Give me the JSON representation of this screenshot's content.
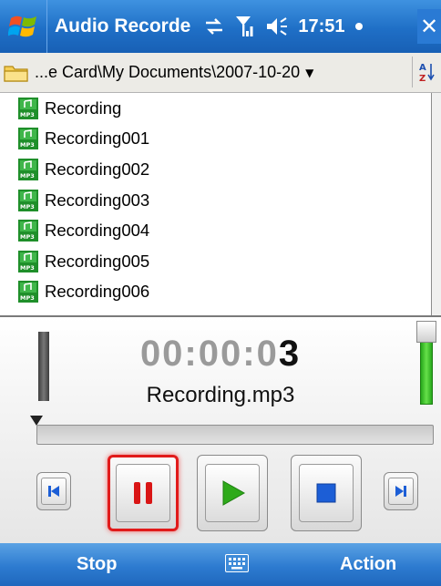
{
  "titlebar": {
    "app_title": "Audio Recorde",
    "time": "17:51",
    "close_label": "✕"
  },
  "pathbar": {
    "path": "...e Card\\My Documents\\2007-10-20"
  },
  "files": [
    {
      "name": "Recording"
    },
    {
      "name": "Recording001"
    },
    {
      "name": "Recording002"
    },
    {
      "name": "Recording003"
    },
    {
      "name": "Recording004"
    },
    {
      "name": "Recording005"
    },
    {
      "name": "Recording006"
    }
  ],
  "player": {
    "timer_dim": "00:00:0",
    "timer_lit": "3",
    "filename": "Recording.mp3",
    "progress": 0
  },
  "softkeys": {
    "left": "Stop",
    "right": "Action"
  },
  "colors": {
    "accent": "#2d7bd0",
    "record_active": "#e11b1b",
    "play_green": "#2eaa1a",
    "stop_blue": "#1c5ed6"
  }
}
